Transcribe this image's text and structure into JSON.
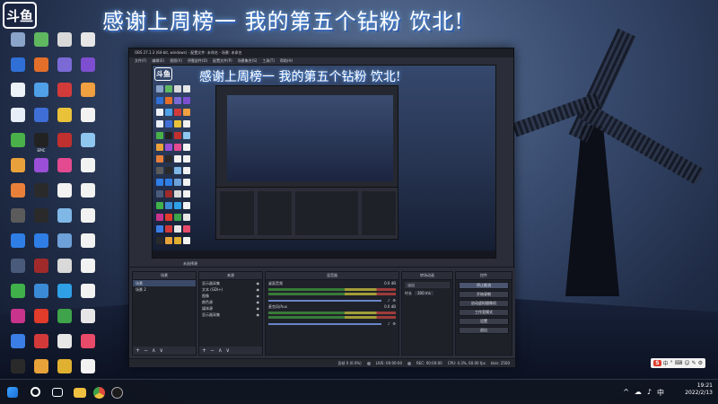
{
  "stream": {
    "logo_text": "斗鱼",
    "banner_text": "感谢上周榜一 我的第五个钻粉 饮北!"
  },
  "desktop_icons": [
    {
      "label": "",
      "color": "#8aa3c9",
      "col": 0,
      "row": 0
    },
    {
      "label": "",
      "color": "#5fb860",
      "col": 1,
      "row": 0
    },
    {
      "label": "",
      "color": "#d9d9d9",
      "col": 2,
      "row": 0
    },
    {
      "label": "",
      "color": "#e6e6e6",
      "col": 3,
      "row": 0
    },
    {
      "label": "",
      "color": "#2f6fd6",
      "col": 0,
      "row": 1
    },
    {
      "label": "",
      "color": "#e36f2a",
      "col": 1,
      "row": 1
    },
    {
      "label": "",
      "color": "#7b6ad6",
      "col": 2,
      "row": 1
    },
    {
      "label": "",
      "color": "#7d4fd0",
      "col": 3,
      "row": 1
    },
    {
      "label": "",
      "color": "#ecf0f7",
      "col": 0,
      "row": 2
    },
    {
      "label": "",
      "color": "#4fa0e8",
      "col": 1,
      "row": 2
    },
    {
      "label": "",
      "color": "#d33b3b",
      "col": 2,
      "row": 2
    },
    {
      "label": "",
      "color": "#f0a040",
      "col": 3,
      "row": 2
    },
    {
      "label": "",
      "color": "#e8eef7",
      "col": 0,
      "row": 3
    },
    {
      "label": "",
      "color": "#3f6fd6",
      "col": 1,
      "row": 3
    },
    {
      "label": "",
      "color": "#eac23a",
      "col": 2,
      "row": 3
    },
    {
      "label": "",
      "color": "#f2f2f2",
      "col": 3,
      "row": 3
    },
    {
      "label": "",
      "color": "#4ab04a",
      "col": 0,
      "row": 4
    },
    {
      "label": "EPIC",
      "color": "#222222",
      "col": 1,
      "row": 4
    },
    {
      "label": "",
      "color": "#c0302f",
      "col": 2,
      "row": 4
    },
    {
      "label": "",
      "color": "#8fc6f0",
      "col": 3,
      "row": 4
    },
    {
      "label": "",
      "color": "#e9a23b",
      "col": 0,
      "row": 5
    },
    {
      "label": "",
      "color": "#9a4fd6",
      "col": 1,
      "row": 5
    },
    {
      "label": "",
      "color": "#e44a8f",
      "col": 2,
      "row": 5
    },
    {
      "label": "",
      "color": "#f2f2f2",
      "col": 3,
      "row": 5
    },
    {
      "label": "",
      "color": "#e8803a",
      "col": 0,
      "row": 6
    },
    {
      "label": "",
      "color": "#2a2a2a",
      "col": 1,
      "row": 6
    },
    {
      "label": "",
      "color": "#f2f2f2",
      "col": 2,
      "row": 6
    },
    {
      "label": "",
      "color": "#f2f2f2",
      "col": 3,
      "row": 6
    },
    {
      "label": "",
      "color": "#5b5b5b",
      "col": 0,
      "row": 7
    },
    {
      "label": "",
      "color": "#2a2a2a",
      "col": 1,
      "row": 7
    },
    {
      "label": "",
      "color": "#7fb7e6",
      "col": 2,
      "row": 7
    },
    {
      "label": "",
      "color": "#f2f2f2",
      "col": 3,
      "row": 7
    },
    {
      "label": "",
      "color": "#2f7ee6",
      "col": 0,
      "row": 8
    },
    {
      "label": "",
      "color": "#2f7ee6",
      "col": 1,
      "row": 8
    },
    {
      "label": "",
      "color": "#6ea0d9",
      "col": 2,
      "row": 8
    },
    {
      "label": "",
      "color": "#f2f2f2",
      "col": 3,
      "row": 8
    },
    {
      "label": "",
      "color": "#4a5a7a",
      "col": 0,
      "row": 9
    },
    {
      "label": "",
      "color": "#a02a2a",
      "col": 1,
      "row": 9
    },
    {
      "label": "",
      "color": "#d9d9d9",
      "col": 2,
      "row": 9
    },
    {
      "label": "",
      "color": "#f2f2f2",
      "col": 3,
      "row": 9
    },
    {
      "label": "",
      "color": "#3fb04a",
      "col": 0,
      "row": 10
    },
    {
      "label": "",
      "color": "#3b8ad6",
      "col": 1,
      "row": 10
    },
    {
      "label": "",
      "color": "#2fa0e6",
      "col": 2,
      "row": 10
    },
    {
      "label": "",
      "color": "#f2f2f2",
      "col": 3,
      "row": 10
    },
    {
      "label": "",
      "color": "#c8348c",
      "col": 0,
      "row": 11
    },
    {
      "label": "",
      "color": "#e03b2b",
      "col": 1,
      "row": 11
    },
    {
      "label": "",
      "color": "#3ea34a",
      "col": 2,
      "row": 11
    },
    {
      "label": "",
      "color": "#e6e6e6",
      "col": 3,
      "row": 11
    },
    {
      "label": "",
      "color": "#3a7ee6",
      "col": 0,
      "row": 12
    },
    {
      "label": "",
      "color": "#d23a3a",
      "col": 1,
      "row": 12
    },
    {
      "label": "",
      "color": "#e6e6e6",
      "col": 2,
      "row": 12
    },
    {
      "label": "",
      "color": "#e84a6a",
      "col": 3,
      "row": 12
    },
    {
      "label": "",
      "color": "#2a2a2a",
      "col": 0,
      "row": 13
    },
    {
      "label": "",
      "color": "#e8a23a",
      "col": 1,
      "row": 13
    },
    {
      "label": "",
      "color": "#e0b030",
      "col": 2,
      "row": 13
    },
    {
      "label": "",
      "color": "#f2f2f2",
      "col": 3,
      "row": 13
    }
  ],
  "obs": {
    "window_title": "OBS 27.1.3 (64-bit, windows) - 配置文件: 未命名 - 场景: 未命名",
    "menus": [
      "文件(F)",
      "编辑(E)",
      "视图(V)",
      "停靠部件(D)",
      "配置文件(P)",
      "场景集合(S)",
      "工具(T)",
      "帮助(H)"
    ],
    "preview_title": "感谢上周榜一 我的第五个钻粉 饮北!",
    "nested_preview_title": "感谢上周榜一 我的第五个钻粉 饮北!",
    "source_selected_notice": "未选择源",
    "docks": {
      "scenes": {
        "header": "场景",
        "items": [
          "场景",
          "场景 2"
        ]
      },
      "sources": {
        "header": "来源",
        "items": [
          "显示器采集",
          "文本 (GDI+)",
          "图像",
          "颜色源",
          "媒体源",
          "显示器采集"
        ]
      },
      "mixer": {
        "header": "混音器",
        "channels": [
          {
            "name": "桌面音频",
            "db": "0.0 dB"
          },
          {
            "name": "麦克风/Aux",
            "db": "0.0 dB"
          }
        ]
      },
      "transitions": {
        "header": "转场动画",
        "type": "淡出",
        "duration_label": "时长",
        "duration": "300 ms"
      },
      "controls": {
        "header": "控件",
        "buttons": [
          "停止推流",
          "开始录制",
          "启动虚拟摄像机",
          "工作室模式",
          "设置",
          "退出"
        ]
      }
    },
    "status": {
      "dropped": "丢帧 0 (0.0%)",
      "live": "LIVE: 00:00:00",
      "rec": "REC: 00:00:00",
      "cpu": "CPU: 4.3%, 60.00 fps",
      "bitrate": "kb/s: 2500"
    },
    "toolbar_glyphs": [
      "+",
      "−",
      "∧",
      "∨"
    ]
  },
  "ime": {
    "label_s": "S",
    "items": [
      "中",
      "°",
      "⌨",
      "☺",
      "✎",
      "⚙"
    ]
  },
  "taskbar": {
    "time": "19:21",
    "date": "2022/2/13",
    "tray": [
      "^",
      "☁",
      "♪",
      "中"
    ]
  }
}
